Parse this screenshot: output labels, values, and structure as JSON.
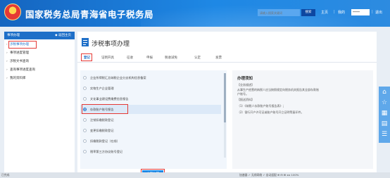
{
  "header": {
    "site_title": "国家税务总局青海省电子税务局",
    "search_placeholder": "请输入搜索关键词",
    "search_button": "搜索",
    "nav_home": "主页",
    "nav_my": "我的",
    "nav_exit": "退出",
    "user_name": "*****",
    "colors": {
      "bg": "#1565c0",
      "accent": "#1e88e5"
    }
  },
  "sidebar": {
    "head_label": "事项办理",
    "back_label": "返回主页",
    "items": [
      {
        "label": "涉税事项办理",
        "active": true
      },
      {
        "label": "事项进度管理",
        "active": false
      },
      {
        "label": "涉税文书查询",
        "active": false
      },
      {
        "label": "查询事项进度查询",
        "active": false
      },
      {
        "label": "我的资料库",
        "active": false
      }
    ]
  },
  "main": {
    "page_title": "涉税事项办理",
    "tabs": [
      {
        "label": "登记",
        "active": true
      },
      {
        "label": "证明开具",
        "active": false
      },
      {
        "label": "征收",
        "active": false
      },
      {
        "label": "申报",
        "active": false
      },
      {
        "label": "税收减免",
        "active": false
      },
      {
        "label": "认定",
        "active": false
      },
      {
        "label": "发票",
        "active": false
      }
    ],
    "list": [
      {
        "label": "企业所得税汇总纳税企业分支机构信息备案",
        "selected": false
      },
      {
        "label": "实物生产企业管理",
        "selected": false
      },
      {
        "label": "文化事业建设费缴费信息报告",
        "selected": false
      },
      {
        "label": "存款账户账号报告",
        "selected": true
      },
      {
        "label": "注销扣缴税款登记",
        "selected": false
      },
      {
        "label": "变更扣缴税款登记",
        "selected": false
      },
      {
        "label": "扣缴税款登记（在线）",
        "selected": false
      },
      {
        "label": "税率第三方协议账号登记",
        "selected": false
      }
    ],
    "submit_label": "立即办理",
    "notice": {
      "title": "办理须知",
      "lines": [
        "【业务描述】",
        "从事生产经营的纳税人应当按照规定向税务机关报告其全部存款账",
        "户账号。",
        "【报送资料】",
        "（1）《纳税人存款账户账号报告表》；",
        "（2）银行开户许可证或账户账号开立证明等复印件。"
      ]
    }
  },
  "float_icons": [
    "home-icon",
    "star-icon",
    "qr-icon",
    "doc-icon",
    "list-icon"
  ],
  "taskbar": {
    "left_text": "已完成",
    "tray_text": "加速器  ✓ 无线网络  ✓ 自动适配  ⊕  ⊟  ⊞  ◂ ▸  100%"
  }
}
